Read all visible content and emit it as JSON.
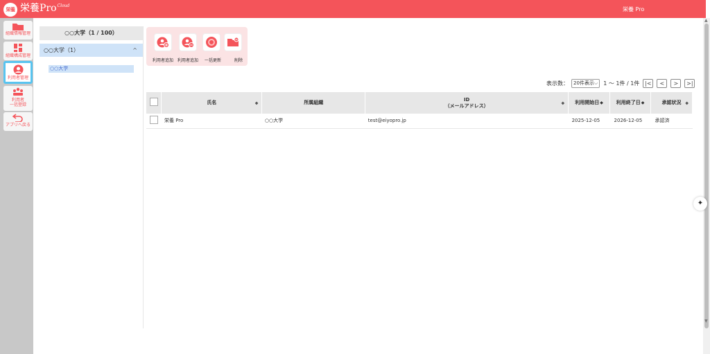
{
  "app": {
    "logo_badge": "栄養",
    "logo_text": "栄養Pro",
    "logo_sup": "Cloud",
    "user": "栄養 Pro"
  },
  "sidenav": [
    {
      "label": "組織情報管理",
      "icon": "folder-icon"
    },
    {
      "label": "組織構成管理",
      "icon": "org-grid-icon"
    },
    {
      "label": "利用者管理",
      "icon": "user-circle-icon",
      "active": true
    },
    {
      "label_line1": "利用者",
      "label_line2": "一括登録",
      "icon": "bulk-users-icon"
    },
    {
      "label": "アプリへ戻る",
      "icon": "return-arrow-icon"
    }
  ],
  "org": {
    "title": "○○大学（1 / 100）",
    "group": "○○大学（1）",
    "sub": "○○大学"
  },
  "toolbar": [
    {
      "label": "利用者追加",
      "icon": "add-user-icon"
    },
    {
      "label": "利用者追加",
      "icon": "add-users-icon"
    },
    {
      "label": "一括更新",
      "icon": "refresh-icon"
    },
    {
      "label": "削除",
      "icon": "delete-folder-icon"
    }
  ],
  "pager": {
    "label": "表示数：",
    "per_page": "20件表示",
    "range": "1 〜 1件 / 1件",
    "first": "|<",
    "prev": "<",
    "next": ">",
    "last": ">|"
  },
  "table": {
    "headers": {
      "name": "氏名",
      "org": "所属組織",
      "id_line1": "ID",
      "id_line2": "（メールアドレス）",
      "start": "利用開始日",
      "end": "利用終了日",
      "status": "承認状況"
    },
    "rows": [
      {
        "name": "栄養 Pro",
        "org": "○○大学",
        "email": "test@eiyopro.jp",
        "start": "2025-12-05",
        "end": "2026-12-05",
        "status": "承認済"
      }
    ]
  },
  "colors": {
    "brand": "#f4545a",
    "active_border": "#58c4f0",
    "selected_bg": "#cfe3f8"
  }
}
